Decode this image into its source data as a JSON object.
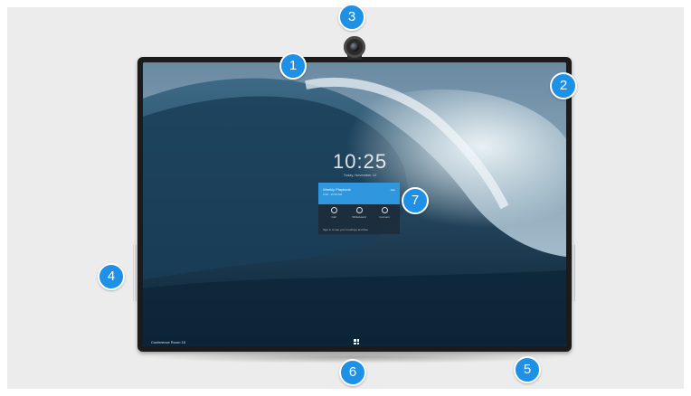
{
  "screen": {
    "time": "10:25",
    "date": "Today, November 12",
    "room_name": "Conference Room 15"
  },
  "meeting_card": {
    "title": "Weekly Playbook",
    "subtitle": "9:30 - 10:30 AM",
    "join_label": "Join",
    "actions": [
      {
        "label": "Call",
        "icon": "call-icon"
      },
      {
        "label": "Whiteboard",
        "icon": "whiteboard-icon"
      },
      {
        "label": "Connect",
        "icon": "connect-icon"
      }
    ],
    "footer": "Sign in to see your meetings and files"
  },
  "callouts": [
    "1",
    "2",
    "3",
    "4",
    "5",
    "6",
    "7"
  ],
  "colors": {
    "callout": "#1e90e6",
    "card_header": "#2e97de",
    "bezel": "#1b1b1b"
  }
}
